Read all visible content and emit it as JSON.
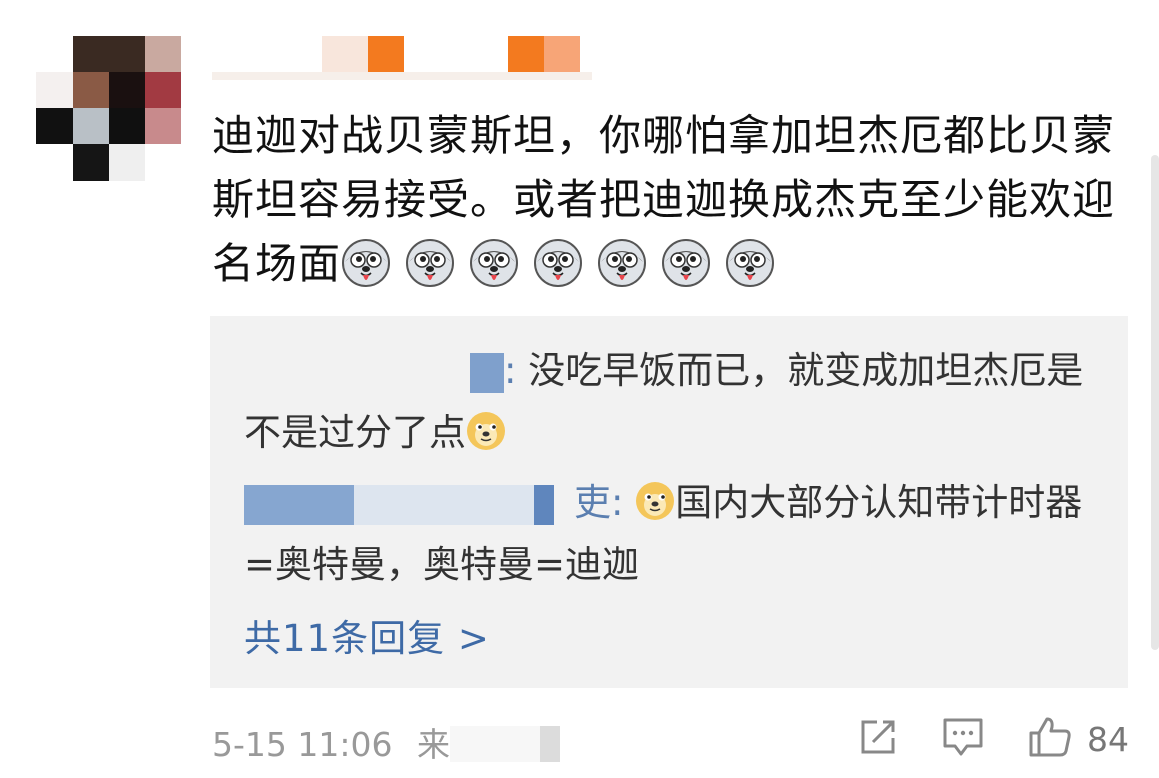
{
  "comment": {
    "text": "迪迦对战贝蒙斯坦，你哪怕拿加坦杰厄都比贝蒙斯坦容易接受。或者把迪迦换成杰克至少能欢迎名场面",
    "emoji_count": 7,
    "emoji_icon": "husky-emoji-icon"
  },
  "replies": [
    {
      "name_suffix": ":",
      "text": "没吃早饭而已，就变成加坦杰厄是不是过分了点"
    },
    {
      "name_suffix": "吏:",
      "text": "国内大部分认知带计时器=奥特曼，奥特曼=迪迦"
    }
  ],
  "more_replies": "共11条回复 >",
  "meta": {
    "time": "5-15 11:06",
    "source_prefix": "来"
  },
  "actions": {
    "like_count": "84"
  },
  "colors": {
    "link": "#3e6aa6",
    "accent_orange": "#f37a1f",
    "reply_bg": "#f2f2f2"
  }
}
